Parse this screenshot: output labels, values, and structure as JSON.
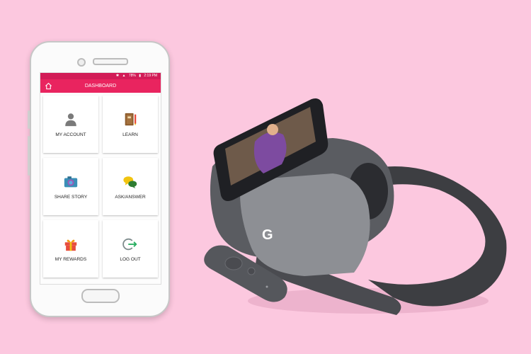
{
  "status_bar": {
    "battery": "78%",
    "time": "2:19 PM",
    "icons": [
      "bluetooth-icon",
      "vibrate-icon",
      "signal-icon",
      "battery-icon"
    ]
  },
  "app_bar": {
    "title": "DASHBOARD",
    "home_icon": "home-icon"
  },
  "dashboard": {
    "tiles": [
      {
        "label": "MY ACCOUNT",
        "icon": "person-icon"
      },
      {
        "label": "LEARN",
        "icon": "book-icon"
      },
      {
        "label": "SHARE STORY",
        "icon": "camera-icon"
      },
      {
        "label": "ASK/ANSWER",
        "icon": "chat-bubbles-icon"
      },
      {
        "label": "MY REWARDS",
        "icon": "gift-icon"
      },
      {
        "label": "LOG OUT",
        "icon": "logout-icon"
      }
    ]
  },
  "colors": {
    "background": "#fcc8df",
    "primary": "#e9245f",
    "status_bar": "#d21c57"
  }
}
